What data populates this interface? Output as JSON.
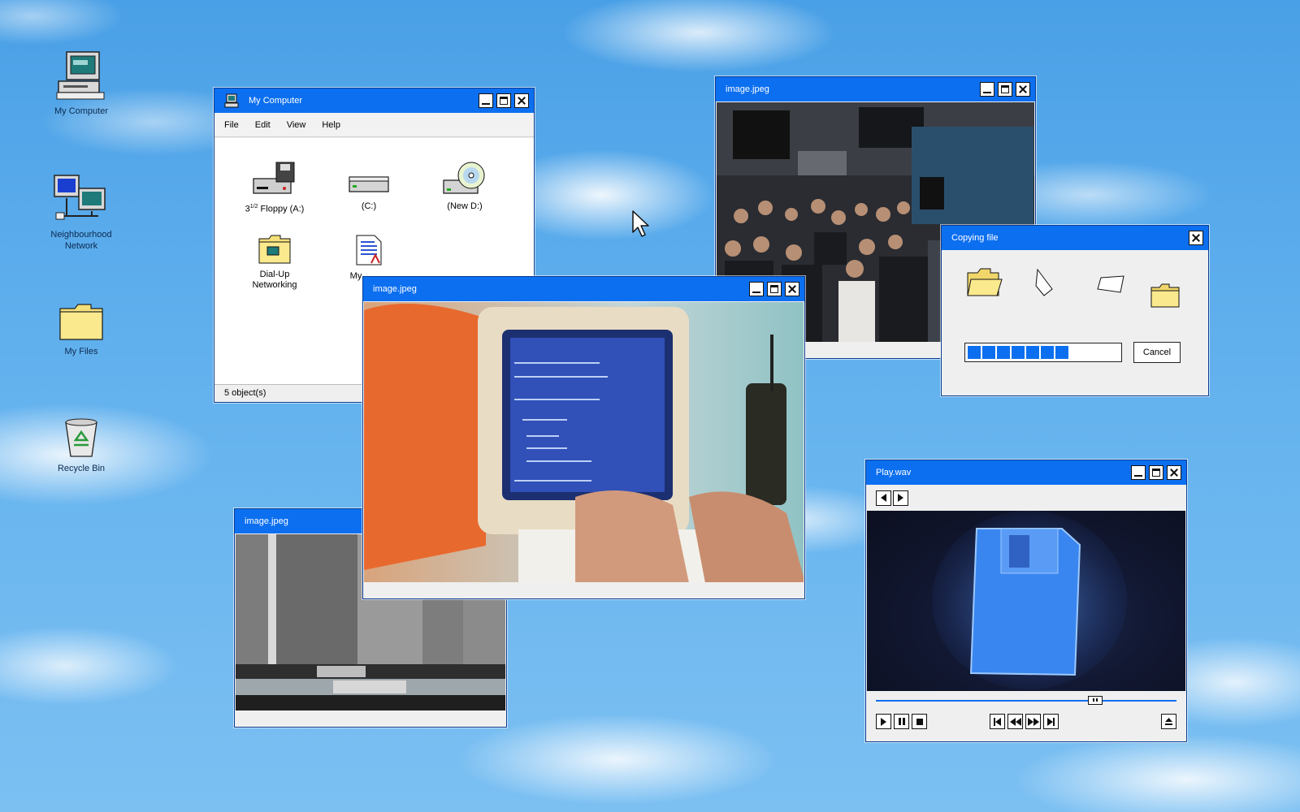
{
  "desktop": {
    "icons": [
      {
        "label": "My Computer",
        "icon": "computer-icon"
      },
      {
        "label": "Neighbourhood Network",
        "icon": "network-icon"
      },
      {
        "label": "My Files",
        "icon": "folder-icon"
      },
      {
        "label": "Recycle Bin",
        "icon": "recycle-bin-icon"
      }
    ]
  },
  "my_computer": {
    "title": "My Computer",
    "menu": [
      "File",
      "Edit",
      "View",
      "Help"
    ],
    "items": [
      {
        "label": "3½ Floppy (A:)",
        "label_main": "3",
        "label_sup": "1/2",
        "label_rest": " Floppy (A:)",
        "icon": "floppy-drive-icon"
      },
      {
        "label": "(C:)",
        "icon": "hard-drive-icon"
      },
      {
        "label": "(New D:)",
        "icon": "cd-drive-icon"
      },
      {
        "label": "Dial-Up Networking",
        "icon": "dialup-folder-icon"
      },
      {
        "label": "My",
        "icon": "document-icon"
      }
    ],
    "status": "5 object(s)"
  },
  "image_windows": [
    {
      "title": "image.jpeg",
      "subject": "crowd at a party"
    },
    {
      "title": "image.jpeg",
      "subject": "computer with hands typing"
    },
    {
      "title": "image.jpeg",
      "subject": "tv static"
    }
  ],
  "copy_dialog": {
    "title": "Copying file",
    "progress_segments": 8,
    "progress": 0.72,
    "cancel_label": "Cancel"
  },
  "player": {
    "title": "Play.wav",
    "seek_position": 0.73
  },
  "colors": {
    "titlebar": "#0c6ff0",
    "window_bg": "#efefef",
    "sky": "#62b1ee"
  }
}
